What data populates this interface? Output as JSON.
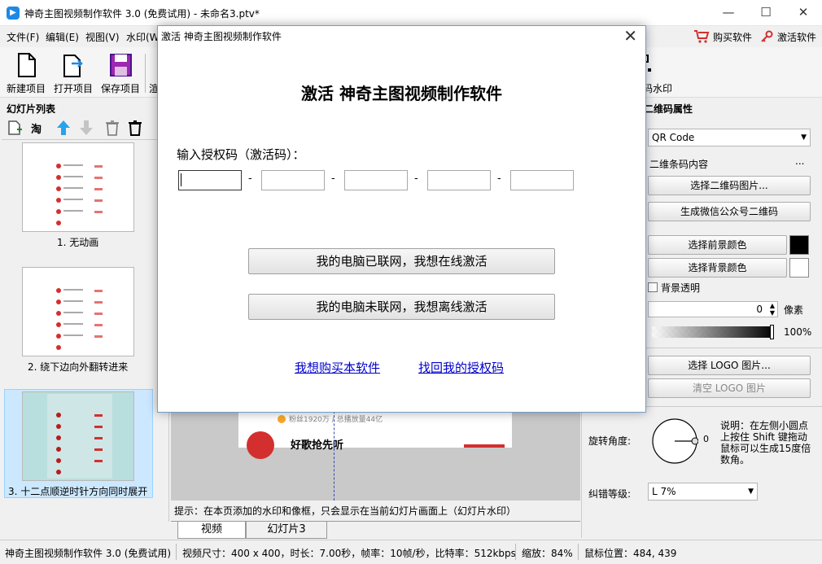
{
  "window": {
    "title": "神奇主图视频制作软件 3.0 (免费试用) - 未命名3.ptv*",
    "min_label": "—",
    "max_label": "☐",
    "close_label": "✕"
  },
  "menu": {
    "items": [
      "文件(F)",
      "编辑(E)",
      "视图(V)",
      "水印(W"
    ],
    "buy_label": "购买软件",
    "activate_label": "激活软件"
  },
  "toolbar": {
    "new_label": "新建项目",
    "open_label": "打开项目",
    "save_label": "保存项目",
    "partial_label": "渲",
    "qr_label": "码水印"
  },
  "left": {
    "header": "幻灯片列表",
    "taobao_label": "淘",
    "slides": [
      {
        "caption": "1. 无动画"
      },
      {
        "caption": "2. 绕下边向外翻转进来"
      },
      {
        "caption": "3. 十二点顺逆时针方向同时展开"
      }
    ]
  },
  "canvas": {
    "fans_text": "粉丝1920万 / 总播放量44亿",
    "song_text": "好歌抢先听"
  },
  "hint": "提示：在本页添加的水印和像框，只会显示在当前幻灯片画面上（幻灯片水印）",
  "tabs": [
    "视频",
    "幻灯片3"
  ],
  "right": {
    "header": "二维码属性",
    "type_value": "QR Code",
    "content_label": "二维条码内容",
    "content_btn": "...",
    "choose_qr_image": "选择二维码图片...",
    "gen_wechat_qr": "生成微信公众号二维码",
    "choose_fg": "选择前景颜色",
    "choose_bg": "选择背景颜色",
    "fg_color": "#000000",
    "bg_color": "#ffffff",
    "bg_transparent_label": "背景透明",
    "pixel_value": "0",
    "pixel_unit": "像素",
    "opacity_label": "100%",
    "opacity": 1.0,
    "choose_logo": "选择 LOGO 图片...",
    "clear_logo": "清空  LOGO 图片",
    "rotation_label": "旋转角度:",
    "rotation_value": "0",
    "rotation_note": "说明：在左侧小圆点上按住 Shift 键拖动鼠标可以生成15度倍数角。",
    "ecc_label": "纠错等级:",
    "ecc_value": "L 7%"
  },
  "status": {
    "app": "神奇主图视频制作软件 3.0 (免费试用)",
    "video_info": "视频尺寸：400 x 400，时长：7.00秒，帧率：10帧/秒，比特率：512kbps",
    "zoom": "缩放：84%",
    "mouse": "鼠标位置：484, 439"
  },
  "dialog": {
    "title": "激活 神奇主图视频制作软件",
    "close_label": "✕",
    "heading": "激活 神奇主图视频制作软件",
    "code_label": "输入授权码（激活码）：",
    "codes": [
      "",
      "",
      "",
      "",
      ""
    ],
    "online_btn": "我的电脑已联网，我想在线激活",
    "offline_btn": "我的电脑未联网，我想离线激活",
    "buy_link": "我想购买本软件",
    "retrieve_link": "找回我的授权码"
  },
  "colors": {
    "accent_blue": "#1e88e5",
    "link": "#0000cc",
    "red": "#d32f2f"
  }
}
